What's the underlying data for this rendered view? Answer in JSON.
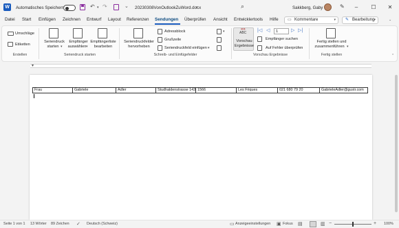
{
  "titlebar": {
    "autosave_label": "Automatisches Speichern",
    "doc_title": "20230308VonOutlookZuWord.docx",
    "user_name": "Sakkberg, Gaby",
    "window_controls": [
      "minimize-icon",
      "maximize-icon",
      "close-icon"
    ]
  },
  "menu": {
    "tabs": [
      "Datei",
      "Start",
      "Einfügen",
      "Zeichnen",
      "Entwurf",
      "Layout",
      "Referenzen",
      "Sendungen",
      "Überprüfen",
      "Ansicht",
      "Entwicklertools",
      "Hilfe"
    ],
    "active_tab": "Sendungen",
    "comments_label": "Kommentare",
    "editing_label": "Bearbeitung"
  },
  "ribbon": {
    "erstellen": {
      "umschlaege": "Umschläge",
      "etiketten": "Etiketten",
      "group": "Erstellen"
    },
    "seriendruck_starten": {
      "starten_1": "Seriendruck",
      "starten_2": "starten",
      "empfaenger_1": "Empfänger",
      "empfaenger_2": "auswählen",
      "liste_1": "Empfängerliste",
      "liste_2": "bearbeiten",
      "group": "Seriendruck starten"
    },
    "schreib": {
      "felder_1": "Seriendruckfelder",
      "felder_2": "hervorheben",
      "adressblock": "Adressblock",
      "grusszeile": "Grußzeile",
      "einfuegen": "Seriendruckfeld einfügen",
      "group": "Schreib- und Einfügefelder"
    },
    "vorschau": {
      "abc": "ABC",
      "vorschau_1": "Vorschau",
      "vorschau_2": "Ergebnisse",
      "record_number": "1",
      "empfaenger_suchen": "Empfänger suchen",
      "fehler": "Auf Fehler überprüfen",
      "group": "Vorschau Ergebnisse"
    },
    "fertig": {
      "fertig_1": "Fertig stellen und",
      "fertig_2": "zusammenführen",
      "group": "Fertig stellen"
    }
  },
  "document": {
    "merge_row": [
      "Frau",
      "Gabriele",
      "Adler",
      "Studhaldenstrasse 143",
      "1566",
      "Les Friques",
      "021 680 79 20",
      "GabrieleAdler@gustr.com"
    ]
  },
  "statusbar": {
    "page": "Seite 1 von 1",
    "words": "13 Wörter",
    "chars": "89 Zeichen",
    "language": "Deutsch (Schweiz)",
    "display_settings": "Anzeigeeinstellungen",
    "focus": "Fokus",
    "zoom": "100%"
  },
  "colors": {
    "accent": "#185abd",
    "save_icon": "#8a2c9e",
    "nav_arrows": "#4a79c6"
  }
}
